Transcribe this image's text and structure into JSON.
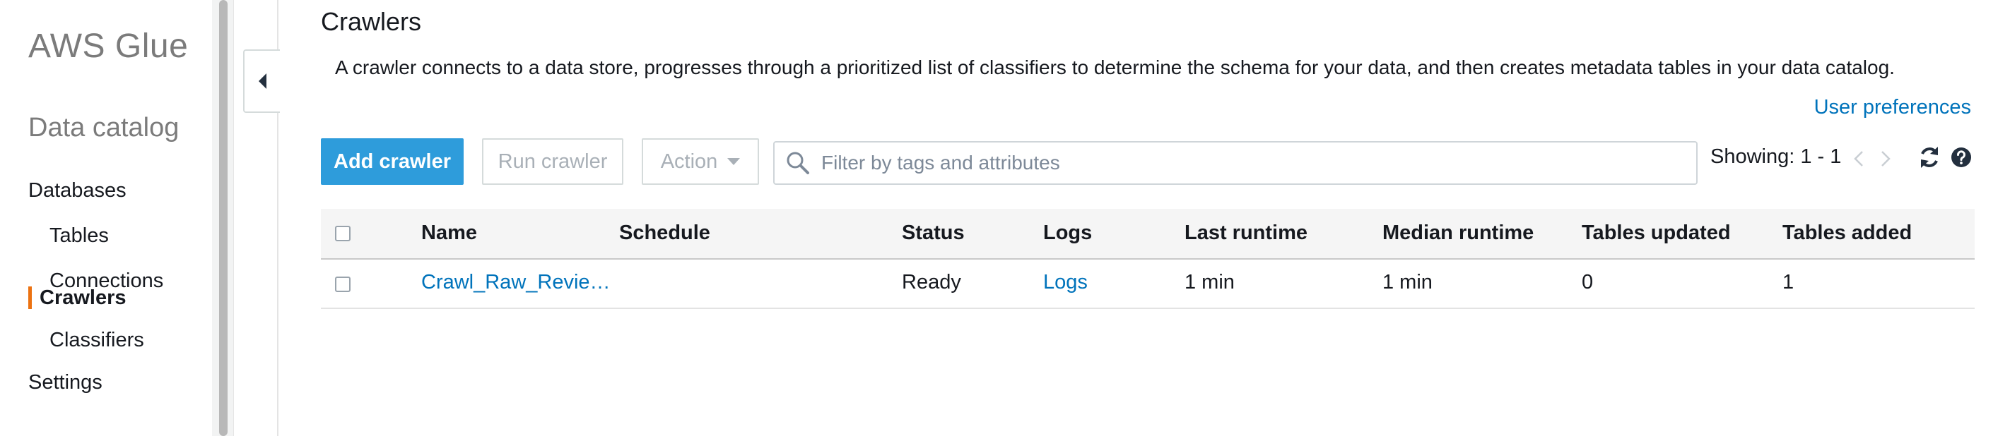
{
  "sidebar": {
    "brand": "AWS Glue",
    "section_title": "Data catalog",
    "items": [
      {
        "label": "Databases"
      },
      {
        "label": "Tables"
      },
      {
        "label": "Connections"
      },
      {
        "label": "Crawlers"
      },
      {
        "label": "Classifiers"
      },
      {
        "label": "Settings"
      }
    ],
    "active_item": "Crawlers",
    "accent_color": "#ec7211"
  },
  "main": {
    "title": "Crawlers",
    "description": "A crawler connects to a data store, progresses through a prioritized list of classifiers to determine the schema for your data, and then creates metadata tables in your data catalog.",
    "user_preferences_label": "User preferences"
  },
  "toolbar": {
    "add_label": "Add crawler",
    "run_label": "Run crawler",
    "action_label": "Action",
    "search_placeholder": "Filter by tags and attributes",
    "showing_label": "Showing: 1 - 1",
    "icons": [
      "search-icon",
      "chevron-left-icon",
      "chevron-right-icon",
      "refresh-icon",
      "help-icon"
    ],
    "primary_color": "#2e9cdb"
  },
  "table": {
    "columns": [
      "Name",
      "Schedule",
      "Status",
      "Logs",
      "Last runtime",
      "Median runtime",
      "Tables updated",
      "Tables added"
    ],
    "rows": [
      {
        "name": "Crawl_Raw_Revie…",
        "schedule": "",
        "status": "Ready",
        "logs": "Logs",
        "last_runtime": "1 min",
        "median_runtime": "1 min",
        "tables_updated": "0",
        "tables_added": "1"
      }
    ],
    "link_color": "#0073bb"
  }
}
